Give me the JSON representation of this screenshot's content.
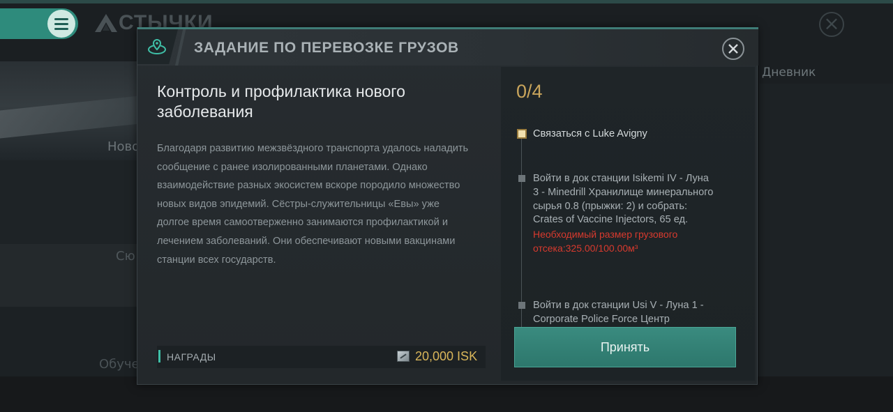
{
  "background": {
    "title": "СТЫЧКИ",
    "left_items": [
      "Ново",
      "Сю",
      "Обуче"
    ],
    "right_tab": "Дневник"
  },
  "dialog": {
    "title": "ЗАДАНИЕ ПО ПЕРЕВОЗКЕ ГРУЗОВ",
    "icon": "map-location-icon",
    "mission_title": "Контроль и профилактика нового заболевания",
    "description": "Благодаря развитию межзвёздного транспорта удалось наладить сообщение с ранее изолированными планетами.  Однако взаимодействие разных экосистем вскоре породило множество новых видов эпидемий. Сёстры-служительницы «Евы» уже долгое время самоотверженно занимаются профилактикой и лечением заболеваний. Они обеспечивают новыми вакцинами станции всех государств.",
    "rewards": {
      "label": "НАГРАДЫ",
      "value": "20,000 ISK",
      "icon": "isk-icon"
    },
    "objectives": {
      "progress": "0/4",
      "steps": [
        {
          "text": "Связаться с Luke Avigny",
          "active": true
        },
        {
          "text": "Войти в док станции Isikemi IV - Луна 3 - Minedrill Хранилище минерального сырья 0.8 (прыжки: 2) и собрать: Crates of Vaccine Injectors, 65 ед.",
          "warning": "Необходимый размер грузового отсека:325.00/100.00м³",
          "active": false
        },
        {
          "text": "Войти в док станции Usi V - Луна 1 - Corporate Police Force Центр",
          "active": false
        }
      ]
    },
    "accept_label": "Принять"
  },
  "colors": {
    "accent_teal": "#2e8b7c",
    "reward_gold": "#d9b65a",
    "warning_red": "#d83a2e"
  }
}
